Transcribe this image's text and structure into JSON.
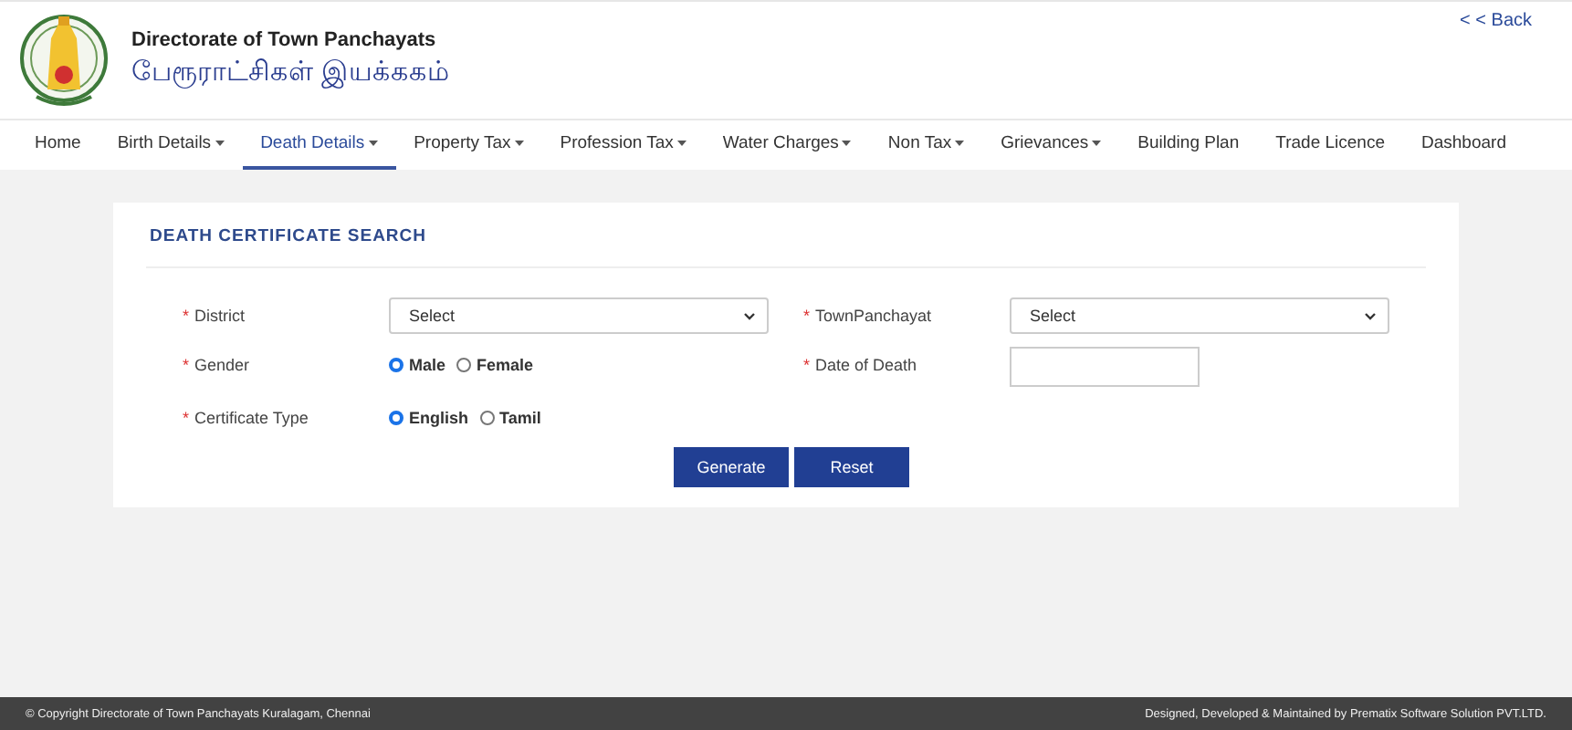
{
  "header": {
    "title": "Directorate of Town Panchayats",
    "subtitle": "பேரூராட்சிகள் இயக்ககம்",
    "back_link": "< < Back"
  },
  "nav": [
    {
      "label": "Home",
      "has_menu": false,
      "selected": false
    },
    {
      "label": "Birth Details",
      "has_menu": true,
      "selected": false
    },
    {
      "label": "Death Details",
      "has_menu": true,
      "selected": true
    },
    {
      "label": "Property Tax",
      "has_menu": true,
      "selected": false
    },
    {
      "label": "Profession Tax",
      "has_menu": true,
      "selected": false
    },
    {
      "label": "Water Charges",
      "has_menu": true,
      "selected": false
    },
    {
      "label": "Non Tax",
      "has_menu": true,
      "selected": false
    },
    {
      "label": "Grievances",
      "has_menu": true,
      "selected": false
    },
    {
      "label": "Building Plan",
      "has_menu": false,
      "selected": false
    },
    {
      "label": "Trade Licence",
      "has_menu": false,
      "selected": false
    },
    {
      "label": "Dashboard",
      "has_menu": false,
      "selected": false
    }
  ],
  "form": {
    "title": "DEATH CERTIFICATE SEARCH",
    "rows": [
      [
        {
          "kind": "select",
          "required_mark": "*",
          "label": "District",
          "value": "Select"
        },
        {
          "kind": "select",
          "required_mark": "*",
          "label": "TownPanchayat",
          "value": "Select"
        }
      ],
      [
        {
          "kind": "radio",
          "required_mark": "*",
          "label": "Gender",
          "options": [
            {
              "label": "Male",
              "selected": true
            },
            {
              "label": "Female",
              "selected": false
            }
          ]
        },
        {
          "kind": "date",
          "required_mark": "*",
          "label": "Date of Death"
        }
      ],
      [
        {
          "kind": "radio",
          "required_mark": "*",
          "label": "Certificate Type",
          "options": [
            {
              "label": "English",
              "selected": true
            },
            {
              "label": "Tamil",
              "selected": false
            }
          ]
        }
      ]
    ],
    "buttons": [
      "Generate",
      "Reset"
    ]
  },
  "footer": {
    "copyright": "© Copyright Directorate of Town Panchayats Kuralagam, Chennai",
    "credit": "Designed, Developed & Maintained by Prematix Software Solution PVT.LTD."
  }
}
